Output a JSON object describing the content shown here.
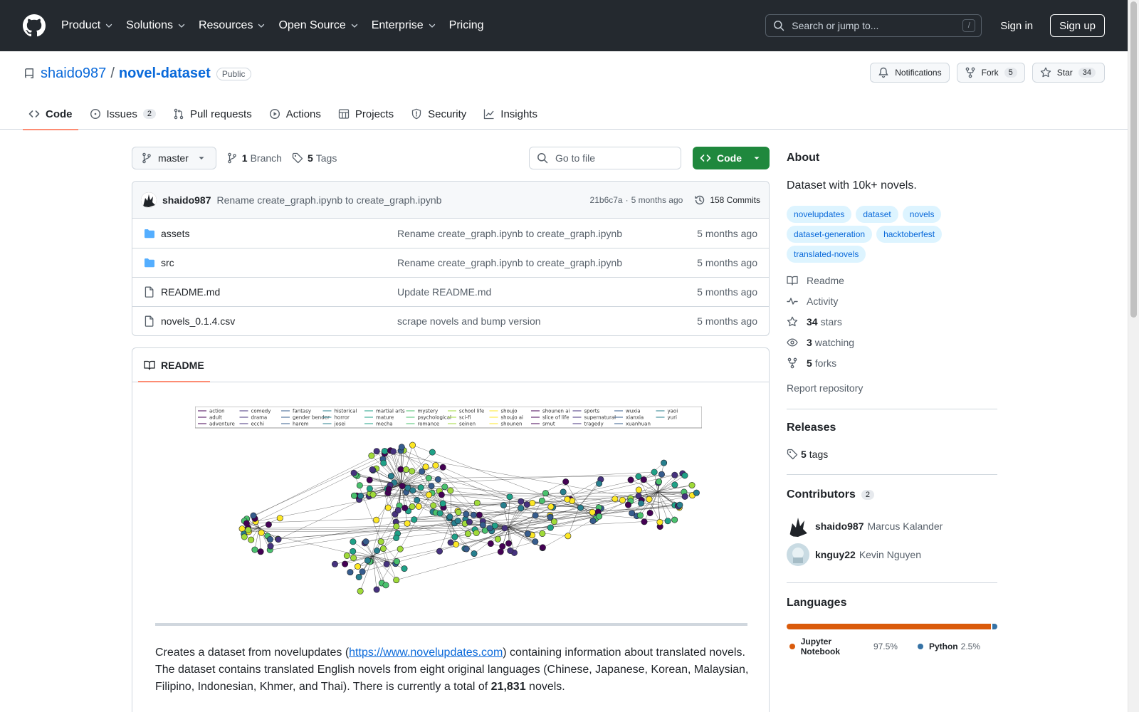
{
  "header": {
    "nav": [
      {
        "label": "Product",
        "has_menu": true
      },
      {
        "label": "Solutions",
        "has_menu": true
      },
      {
        "label": "Resources",
        "has_menu": true
      },
      {
        "label": "Open Source",
        "has_menu": true
      },
      {
        "label": "Enterprise",
        "has_menu": true
      },
      {
        "label": "Pricing",
        "has_menu": false
      }
    ],
    "search_placeholder": "Search or jump to...",
    "search_key": "/",
    "sign_in": "Sign in",
    "sign_up": "Sign up"
  },
  "repo": {
    "owner": "shaido987",
    "separator": "/",
    "name": "novel-dataset",
    "visibility": "Public",
    "notifications_label": "Notifications",
    "fork_label": "Fork",
    "fork_count": "5",
    "star_label": "Star",
    "star_count": "34"
  },
  "tabs": [
    {
      "label": "Code",
      "icon": "code-icon",
      "count": "",
      "active": true
    },
    {
      "label": "Issues",
      "icon": "issue-icon",
      "count": "2",
      "active": false
    },
    {
      "label": "Pull requests",
      "icon": "pull-request-icon",
      "count": "",
      "active": false
    },
    {
      "label": "Actions",
      "icon": "play-icon",
      "count": "",
      "active": false
    },
    {
      "label": "Projects",
      "icon": "table-icon",
      "count": "",
      "active": false
    },
    {
      "label": "Security",
      "icon": "shield-icon",
      "count": "",
      "active": false
    },
    {
      "label": "Insights",
      "icon": "graph-icon",
      "count": "",
      "active": false
    }
  ],
  "toolbar": {
    "branch": "master",
    "branch_count": "1",
    "branch_label": "Branch",
    "tag_count": "5",
    "tag_label": "Tags",
    "goto_placeholder": "Go to file",
    "code_button": "Code"
  },
  "latest_commit": {
    "author": "shaido987",
    "message": "Rename create_graph.ipynb to create_graph.ipynb",
    "sha": "21b6c7a",
    "dot": "·",
    "age": "5 months ago",
    "commits_label": "158 Commits"
  },
  "files": [
    {
      "type": "folder",
      "name": "assets",
      "message": "Rename create_graph.ipynb to create_graph.ipynb",
      "age": "5 months ago"
    },
    {
      "type": "folder",
      "name": "src",
      "message": "Rename create_graph.ipynb to create_graph.ipynb",
      "age": "5 months ago"
    },
    {
      "type": "file",
      "name": "README.md",
      "message": "Update README.md",
      "age": "5 months ago"
    },
    {
      "type": "file",
      "name": "novels_0.1.4.csv",
      "message": "scrape novels and bump version",
      "age": "5 months ago"
    }
  ],
  "readme": {
    "tab_label": "README",
    "legend": [
      "action",
      "comedy",
      "fantasy",
      "historical",
      "martial arts",
      "mystery",
      "school life",
      "shoujo",
      "shounen ai",
      "sports",
      "wuxia",
      "yaoi",
      "adult",
      "drama",
      "gender bender",
      "horror",
      "mature",
      "psychological",
      "sci-fi",
      "shoujo ai",
      "slice of life",
      "supernatural",
      "xianxia",
      "yuri",
      "adventure",
      "ecchi",
      "harem",
      "josei",
      "mecha",
      "romance",
      "seinen",
      "shounen",
      "smut",
      "tragedy",
      "xuanhuan"
    ],
    "para_1": "Creates a dataset from novelupdates (",
    "link": "https://www.novelupdates.com",
    "para_2": ") containing information about translated novels. The dataset contains translated English novels from eight original languages (Chinese, Japanese, Korean, Malaysian, Filipino, Indonesian, Khmer, and Thai). There is currently a total of ",
    "total": "21,831",
    "para_3": " novels."
  },
  "about": {
    "title": "About",
    "description": "Dataset with 10k+ novels.",
    "topics": [
      "novelupdates",
      "dataset",
      "novels",
      "dataset-generation",
      "hacktoberfest",
      "translated-novels"
    ],
    "links": [
      {
        "icon": "book-icon",
        "bold": "",
        "label": "Readme"
      },
      {
        "icon": "pulse-icon",
        "bold": "",
        "label": "Activity"
      },
      {
        "icon": "star-icon",
        "bold": "34",
        "label": "stars"
      },
      {
        "icon": "eye-icon",
        "bold": "3",
        "label": "watching"
      },
      {
        "icon": "fork-icon",
        "bold": "5",
        "label": "forks"
      }
    ],
    "report": "Report repository"
  },
  "releases": {
    "title": "Releases",
    "tag_count": "5",
    "tag_label": "tags"
  },
  "contributors": {
    "title": "Contributors",
    "count": "2",
    "people": [
      {
        "login": "shaido987",
        "name": "Marcus Kalander"
      },
      {
        "login": "knguy22",
        "name": "Kevin Nguyen"
      }
    ]
  },
  "languages": {
    "title": "Languages",
    "items": [
      {
        "name": "Jupyter Notebook",
        "percent": "97.5%",
        "value": 97.5,
        "color": "#DA5B0B"
      },
      {
        "name": "Python",
        "percent": "2.5%",
        "value": 2.5,
        "color": "#3572A5"
      }
    ]
  },
  "colors": {
    "header_bg": "#24292f",
    "link": "#0969da",
    "primary_button": "#1f883d",
    "active_tab_underline": "#fd8c73",
    "topic_bg": "#ddf4ff"
  }
}
